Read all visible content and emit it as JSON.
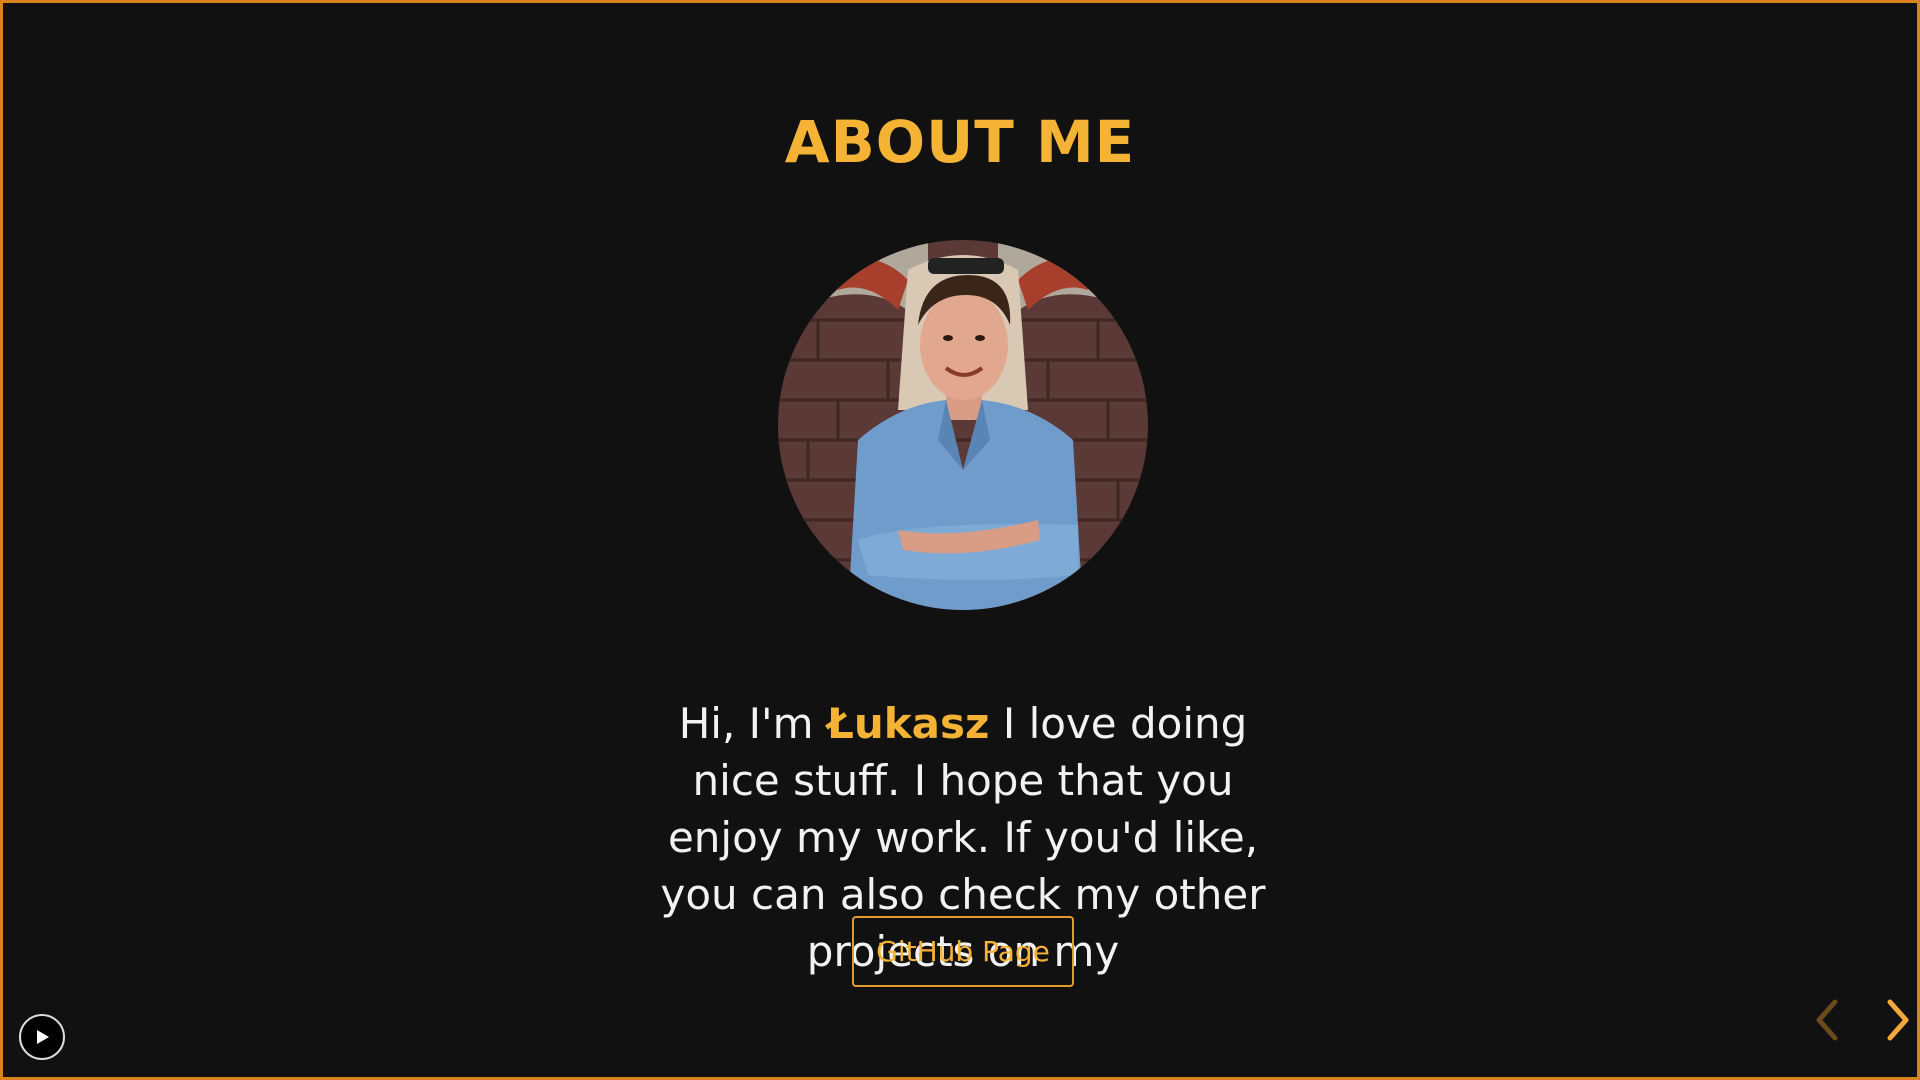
{
  "page": {
    "title": "ABOUT ME"
  },
  "profile": {
    "photo_alt": "Profile photo of Łukasz",
    "bio_prefix": "Hi, I'm",
    "name": "Łukasz",
    "bio_text": "I love doing nice stuff. I hope that you enjoy my work. If you'd like, you can also check my other projects on my"
  },
  "actions": {
    "github_label": "GitHub Page"
  },
  "controls": {
    "play_icon": "play-icon",
    "prev_icon": "chevron-left-icon",
    "next_icon": "chevron-right-icon"
  },
  "colors": {
    "accent": "#f5b335",
    "border": "#d9821f",
    "background": "#111111",
    "text": "#f2f2f2"
  }
}
